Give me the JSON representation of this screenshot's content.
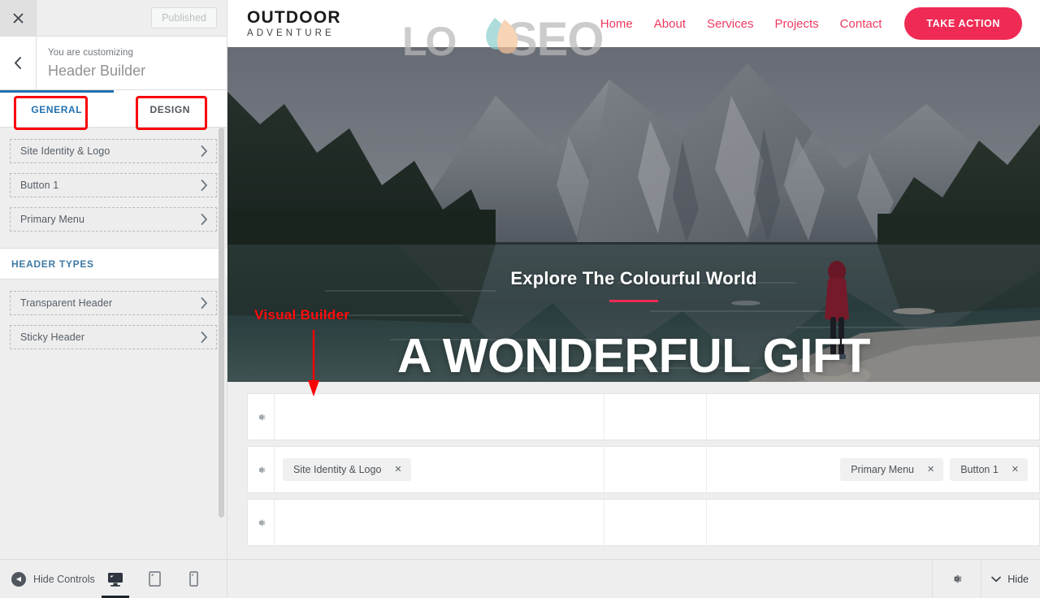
{
  "customizer": {
    "close_icon": "close-icon",
    "publish_button": "Published",
    "back_icon": "chevron-left-icon",
    "eyebrow": "You are customizing",
    "title": "Header Builder",
    "tabs": [
      {
        "label": "GENERAL",
        "active": true
      },
      {
        "label": "DESIGN",
        "active": false
      }
    ],
    "general_items": [
      {
        "label": "Site Identity & Logo"
      },
      {
        "label": "Button 1"
      },
      {
        "label": "Primary Menu"
      }
    ],
    "section_header": "HEADER TYPES",
    "header_type_items": [
      {
        "label": "Transparent Header"
      },
      {
        "label": "Sticky Header"
      }
    ],
    "bottom": {
      "hide_controls": "Hide Controls",
      "devices": [
        {
          "name": "desktop",
          "active": true
        },
        {
          "name": "tablet",
          "active": false
        },
        {
          "name": "mobile",
          "active": false
        }
      ]
    }
  },
  "site": {
    "logo_line1": "OUTDOOR",
    "logo_line2": "ADVENTURE",
    "nav": [
      {
        "label": "Home"
      },
      {
        "label": "About"
      },
      {
        "label": "Services"
      },
      {
        "label": "Projects"
      },
      {
        "label": "Contact"
      }
    ],
    "cta_label": "TAKE ACTION",
    "hero": {
      "subtitle": "Explore The Colourful World",
      "title": "A WONDERFUL GIFT"
    },
    "watermark": "LOYSEO"
  },
  "annotations": {
    "visual_builder_label": "Visual Builder"
  },
  "builder": {
    "rows": [
      {
        "left": [],
        "center": [],
        "right": []
      },
      {
        "left": [
          {
            "label": "Site Identity & Logo"
          }
        ],
        "center": [],
        "right": [
          {
            "label": "Primary Menu"
          },
          {
            "label": "Button 1"
          }
        ]
      },
      {
        "left": [],
        "center": [],
        "right": []
      }
    ]
  },
  "preview_bottom": {
    "gear_icon": "gear-icon",
    "hide_label": "Hide"
  },
  "colors": {
    "accent_pink": "#ef2b55",
    "nav_pink": "#ec3a5e",
    "tab_active_blue": "#2271b1",
    "subheader_blue": "#3f7ba6",
    "annotation_red": "#fb0007",
    "watermark_gray": "#b9b9b9",
    "watermark_teal": "#8ecfcf",
    "watermark_peach": "#f5c49b"
  }
}
